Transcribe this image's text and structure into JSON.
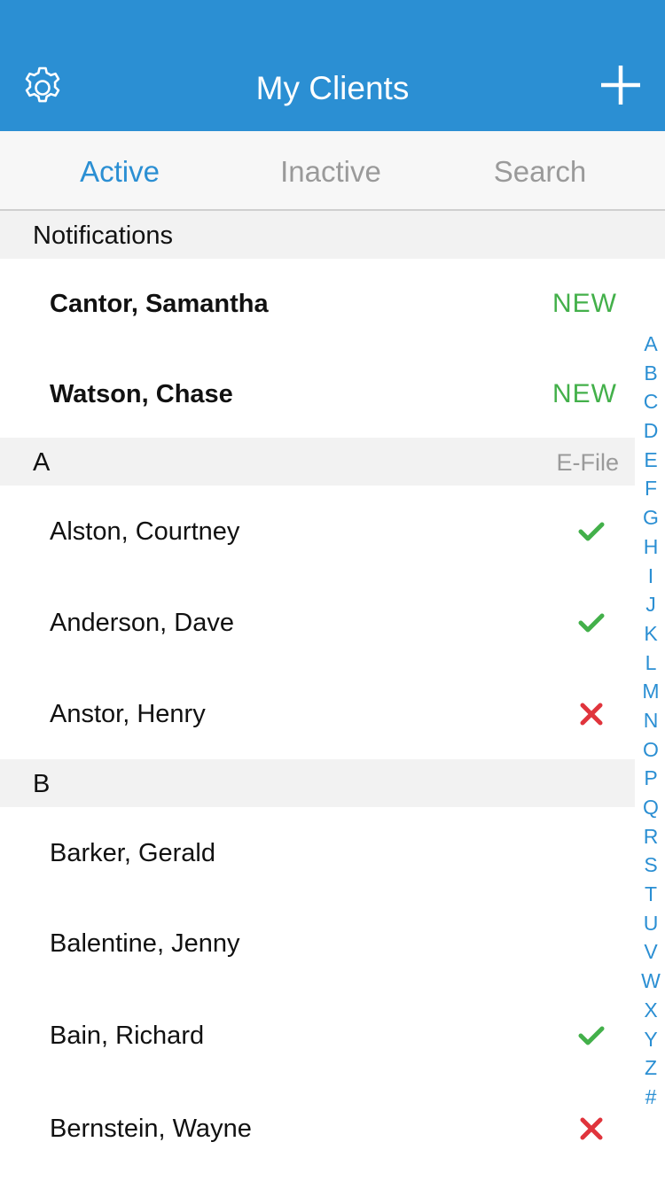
{
  "header": {
    "title": "My Clients",
    "settings_icon": "gear-icon",
    "add_icon": "plus-icon"
  },
  "tabs": [
    {
      "label": "Active"
    },
    {
      "label": "Inactive"
    },
    {
      "label": "Search"
    }
  ],
  "notifications": {
    "title": "Notifications",
    "items": [
      {
        "last": "Cantor",
        "first": "Samantha",
        "status": "NEW"
      },
      {
        "last": "Watson",
        "first": "Chase",
        "status": "NEW"
      }
    ]
  },
  "sections": [
    {
      "letter": "A",
      "right_label": "E-File",
      "clients": [
        {
          "last": "Alston",
          "first": "Courtney",
          "efile": "check"
        },
        {
          "last": "Anderson",
          "first": "Dave",
          "efile": "check"
        },
        {
          "last": "Anstor",
          "first": "Henry",
          "efile": "cross"
        }
      ]
    },
    {
      "letter": "B",
      "clients": [
        {
          "last": "Barker",
          "first": "Gerald",
          "efile": ""
        },
        {
          "last": "Balentine",
          "first": "Jenny",
          "efile": ""
        },
        {
          "last": "Bain",
          "first": "Richard",
          "efile": "check"
        },
        {
          "last": "Bernstein",
          "first": "Wayne",
          "efile": "cross"
        }
      ]
    }
  ],
  "index": [
    "A",
    "B",
    "C",
    "D",
    "E",
    "F",
    "G",
    "H",
    "I",
    "J",
    "K",
    "L",
    "M",
    "N",
    "O",
    "P",
    "Q",
    "R",
    "S",
    "T",
    "U",
    "V",
    "W",
    "X",
    "Y",
    "Z",
    "#"
  ],
  "colors": {
    "nav": "#2b8fd3",
    "accent": "#2b8fd3",
    "new": "#43b04a",
    "check": "#43b04a",
    "cross": "#e0343c"
  }
}
